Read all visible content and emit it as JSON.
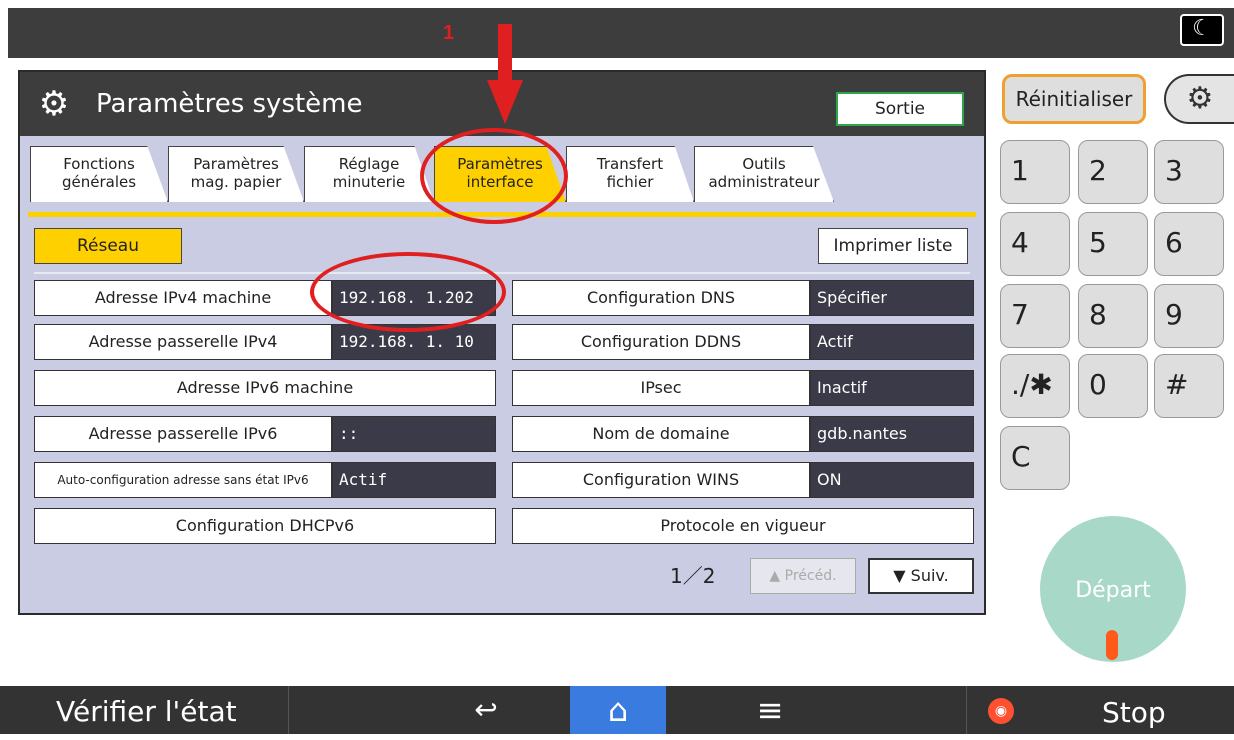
{
  "topbar": {
    "moon_icon": "moon-icon"
  },
  "panel": {
    "title": "Paramètres système",
    "exit_label": "Sortie",
    "tabs": [
      {
        "line1": "Fonctions",
        "line2": "générales"
      },
      {
        "line1": "Paramètres",
        "line2": "mag. papier"
      },
      {
        "line1": "Réglage",
        "line2": "minuterie"
      },
      {
        "line1": "Paramètres",
        "line2": "interface"
      },
      {
        "line1": "Transfert",
        "line2": "fichier"
      },
      {
        "line1": "Outils",
        "line2": "administrateur"
      }
    ],
    "active_tab_index": 3,
    "subtab": "Réseau",
    "print_list": "Imprimer liste",
    "left_rows": [
      {
        "label": "Adresse IPv4 machine",
        "value": "192.168.  1.202"
      },
      {
        "label": "Adresse passerelle IPv4",
        "value": "192.168.  1. 10"
      },
      {
        "label": "Adresse IPv6 machine",
        "value": ""
      },
      {
        "label": "Adresse passerelle IPv6",
        "value": "::"
      },
      {
        "label": "Auto-configuration adresse sans état IPv6",
        "value": "Actif"
      },
      {
        "label": "Configuration DHCPv6",
        "value": ""
      }
    ],
    "right_rows": [
      {
        "label": "Configuration DNS",
        "value": "Spécifier"
      },
      {
        "label": "Configuration DDNS",
        "value": "Actif"
      },
      {
        "label": "IPsec",
        "value": "Inactif"
      },
      {
        "label": "Nom de domaine",
        "value": "gdb.nantes"
      },
      {
        "label": "Configuration WINS",
        "value": "ON"
      },
      {
        "label": "Protocole en vigueur",
        "value": ""
      }
    ],
    "page_indicator": "1／2",
    "prev_label": "Précéd.",
    "next_label": "Suiv."
  },
  "keypad": {
    "reset_label": "Réinitialiser",
    "keys": [
      "1",
      "2",
      "3",
      "4",
      "5",
      "6",
      "7",
      "8",
      "9",
      "./✱",
      "0",
      "#",
      "C"
    ],
    "start_label": "Départ"
  },
  "bottombar": {
    "check_status": "Vérifier l'état",
    "stop_label": "Stop"
  },
  "annotation": {
    "step_number": "1"
  }
}
